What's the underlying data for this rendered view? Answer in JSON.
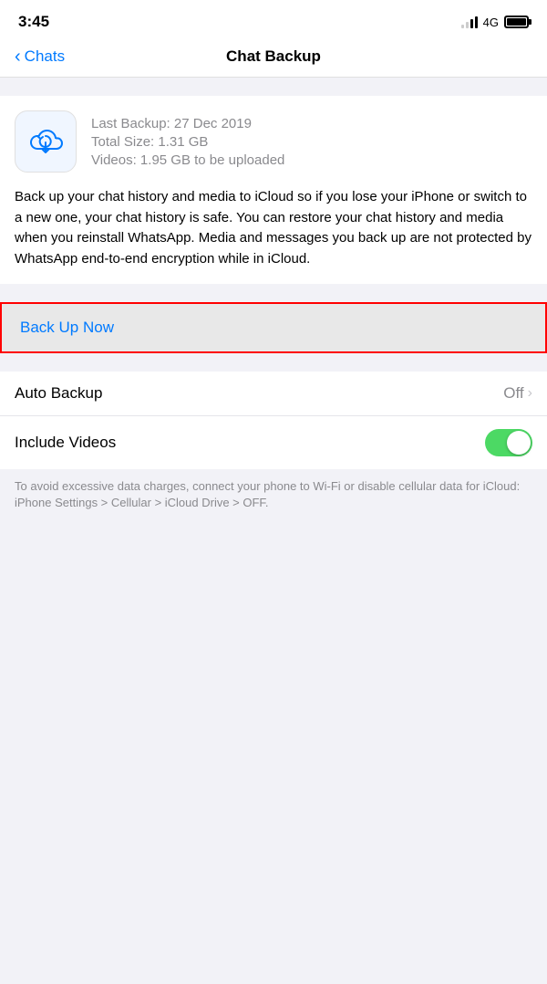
{
  "statusBar": {
    "time": "3:45",
    "network": "4G"
  },
  "navBar": {
    "backLabel": "Chats",
    "title": "Chat Backup"
  },
  "backupCard": {
    "lastBackup": "Last Backup: 27 Dec 2019",
    "totalSize": "Total Size: 1.31 GB",
    "videos": "Videos: 1.95 GB to be uploaded",
    "description": "Back up your chat history and media to iCloud so if you lose your iPhone or switch to a new one, your chat history is safe. You can restore your chat history and media when you reinstall WhatsApp. Media and messages you back up are not protected by WhatsApp end-to-end encryption while in iCloud."
  },
  "backupNowButton": {
    "label": "Back Up Now"
  },
  "settings": {
    "rows": [
      {
        "label": "Auto Backup",
        "value": "Off",
        "hasChevron": true,
        "hasToggle": false
      },
      {
        "label": "Include Videos",
        "value": "",
        "hasChevron": false,
        "hasToggle": true
      }
    ]
  },
  "footerNote": {
    "text": "To avoid excessive data charges, connect your phone to Wi-Fi or disable cellular data for iCloud: iPhone Settings > Cellular > iCloud Drive > OFF."
  }
}
